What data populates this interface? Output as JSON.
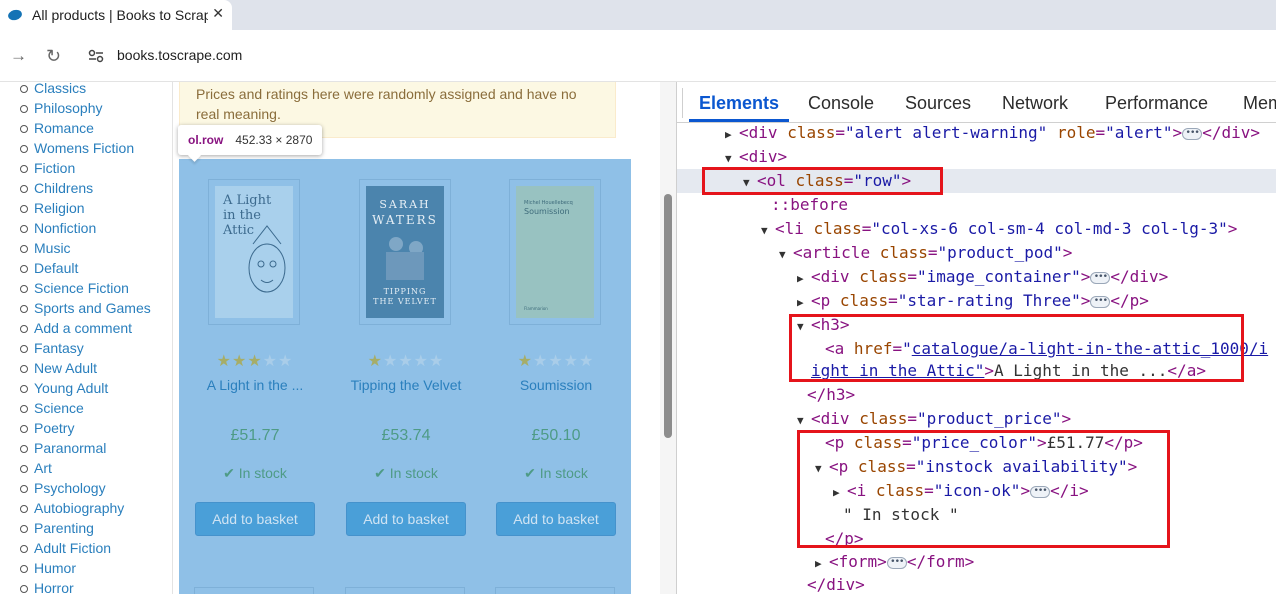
{
  "browser": {
    "tab_title": "All products | Books to Scrape",
    "tab_close": "✕",
    "url": "books.toscrape.com",
    "back": "←",
    "forward": "→",
    "reload": "↻"
  },
  "sidebar": {
    "categories": [
      "Classics",
      "Philosophy",
      "Romance",
      "Womens Fiction",
      "Fiction",
      "Childrens",
      "Religion",
      "Nonfiction",
      "Music",
      "Default",
      "Science Fiction",
      "Sports and Games",
      "Add a comment",
      "Fantasy",
      "New Adult",
      "Young Adult",
      "Science",
      "Poetry",
      "Paranormal",
      "Art",
      "Psychology",
      "Autobiography",
      "Parenting",
      "Adult Fiction",
      "Humor",
      "Horror"
    ]
  },
  "alert": {
    "text": "Prices and ratings here were randomly assigned and have no real meaning."
  },
  "inspect_tooltip": {
    "selector": "ol.row",
    "size": "452.33 × 2870"
  },
  "products": [
    {
      "title": "A Light in the ...",
      "price": "£51.77",
      "stock": "In stock",
      "stars": 3,
      "button": "Add to basket",
      "cover": "A Light in the Attic"
    },
    {
      "title": "Tipping the Velvet",
      "price": "£53.74",
      "stock": "In stock",
      "stars": 1,
      "button": "Add to basket",
      "cover": "Tipping the Velvet"
    },
    {
      "title": "Soumission",
      "price": "£50.10",
      "stock": "In stock",
      "stars": 1,
      "button": "Add to basket",
      "cover": "Soumission"
    }
  ],
  "devtools": {
    "tabs": [
      "Elements",
      "Console",
      "Sources",
      "Network",
      "Performance",
      "Memory"
    ],
    "active_tab": "Elements",
    "dom": {
      "l1_tag": "div",
      "l1_attr1": "class",
      "l1_val1": "\"alert alert-warning\"",
      "l1_attr2": "role",
      "l1_val2": "\"alert\"",
      "l1_close": "</div>",
      "l2_tag": "<div>",
      "l3_tag": "ol",
      "l3_attr": "class",
      "l3_val": "\"row\"",
      "l4_pseudo": "::before",
      "l5_tag": "li",
      "l5_attr": "class",
      "l5_val": "\"col-xs-6 col-sm-4 col-md-3 col-lg-3\"",
      "l6_tag": "article",
      "l6_attr": "class",
      "l6_val": "\"product_pod\"",
      "l7_tag": "div",
      "l7_attr": "class",
      "l7_val": "\"image_container\"",
      "l7_close": "</div>",
      "l8_tag": "p",
      "l8_attr": "class",
      "l8_val": "\"star-rating Three\"",
      "l8_close": "</p>",
      "l9_tag": "<h3>",
      "l10_tag": "a",
      "l10_attr": "href",
      "l10_val_q": "\"",
      "l10_link": "catalogue/a-light-in-the-attic_1000/i",
      "l11_cont": "ight in the Attic\"",
      "l11_text": "A Light in the ...",
      "l11_close": "</a>",
      "l12_close": "</h3>",
      "l13_tag": "div",
      "l13_attr": "class",
      "l13_val": "\"product_price\"",
      "l14_tag": "p",
      "l14_attr": "class",
      "l14_val": "\"price_color\"",
      "l14_text": "£51.77",
      "l14_close": "</p>",
      "l15_tag": "p",
      "l15_attr": "class",
      "l15_val": "\"instock availability\"",
      "l16_tag": "i",
      "l16_attr": "class",
      "l16_val": "\"icon-ok\"",
      "l16_close": "</i>",
      "l17_text": "\" In stock \"",
      "l18_close": "</p>",
      "l19_tag": "form",
      "l19_close": "</form>",
      "l20_close": "</div>"
    }
  },
  "colors": {
    "link": "#2a7fbd",
    "overlay": "#8fc0e7",
    "devtools_active": "#0b57d0",
    "red_box": "#e5141b"
  }
}
